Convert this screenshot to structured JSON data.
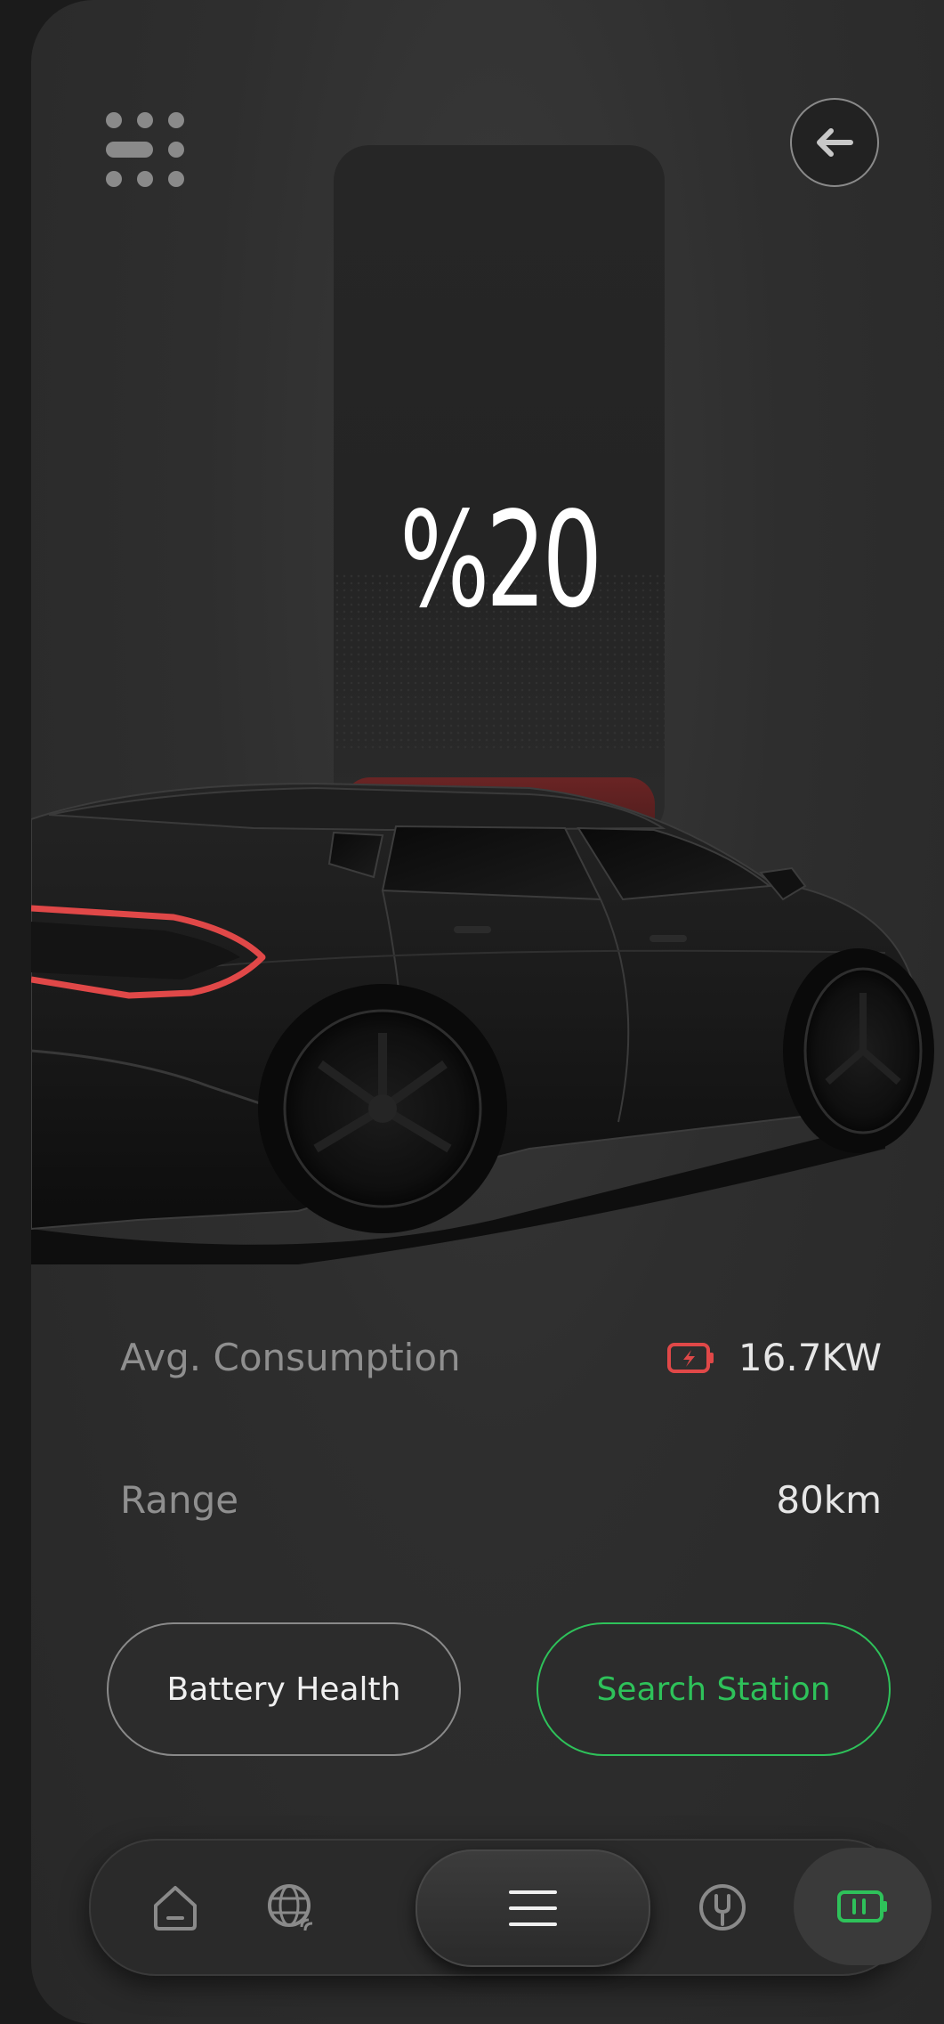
{
  "battery": {
    "percent_label": "%20",
    "level_fraction": 0.2,
    "fill_color": "#5a1f1f"
  },
  "stats": [
    {
      "label": "Avg. Consumption",
      "value": "16.7KW",
      "icon": "battery-charging-icon"
    },
    {
      "label": "Range",
      "value": "80km",
      "icon": ""
    }
  ],
  "buttons": {
    "battery_health": "Battery Health",
    "search_station": "Search Station"
  },
  "nav": {
    "items": [
      "home-icon",
      "globe-icon",
      "menu-icon",
      "wrench-icon",
      "battery-icon"
    ],
    "active": "battery-icon"
  },
  "colors": {
    "accent_green": "#2ec25a",
    "alert_red": "#e04848",
    "background": "#2e2e2e"
  }
}
